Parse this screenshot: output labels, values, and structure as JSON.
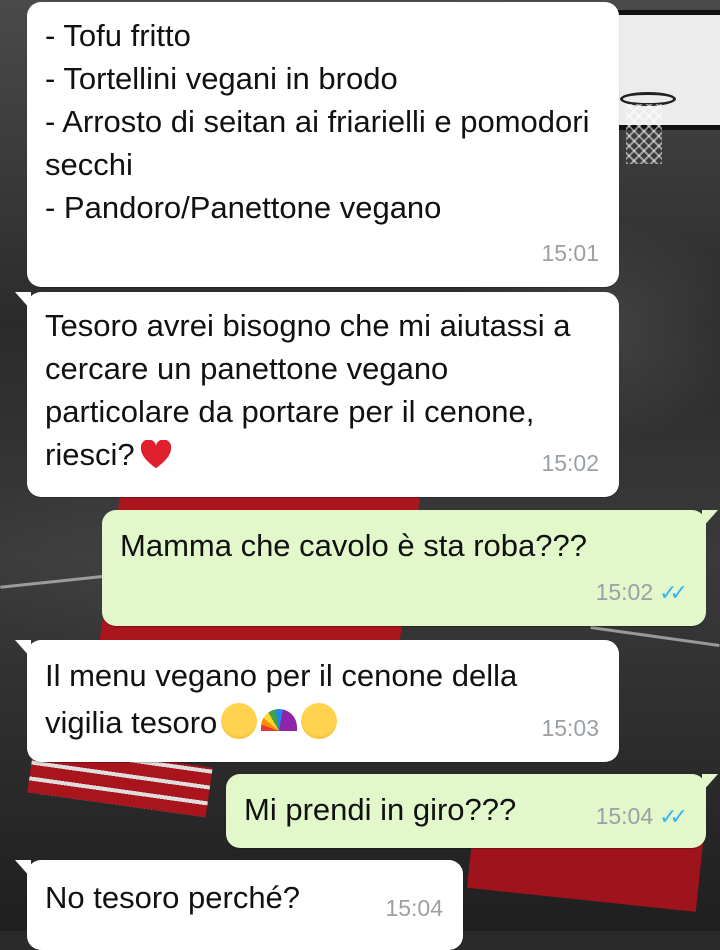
{
  "messages": [
    {
      "direction": "incoming",
      "text": "- Tofu fritto\n- Tortellini vegani in brodo\n- Arrosto di seitan ai friarielli e pomodori secchi\n- Pandoro/Panettone vegano",
      "time": "15:01"
    },
    {
      "direction": "incoming",
      "text": "Tesoro avrei bisogno che mi aiutassi a cercare un panettone vegano particolare da portare per il cenone, riesci?",
      "emoji": [
        "red-heart"
      ],
      "time": "15:02"
    },
    {
      "direction": "outgoing",
      "text": "Mamma che cavolo è sta roba???",
      "time": "15:02",
      "status": "read-double-check"
    },
    {
      "direction": "incoming",
      "text": "Il menu vegano per il cenone della vigilia tesoro",
      "emoji": [
        "smiling-blush-face",
        "rainbow",
        "heart-eyes-face"
      ],
      "time": "15:03"
    },
    {
      "direction": "outgoing",
      "text": "Mi prendi in giro???",
      "time": "15:04",
      "status": "read-double-check"
    },
    {
      "direction": "incoming",
      "text": "No tesoro perché?",
      "time": "15:04"
    }
  ],
  "colors": {
    "incoming_bubble": "#ffffff",
    "outgoing_bubble": "#e2f8cb",
    "timestamp": "#9aa0a4",
    "read_ticks": "#34b7f1"
  }
}
